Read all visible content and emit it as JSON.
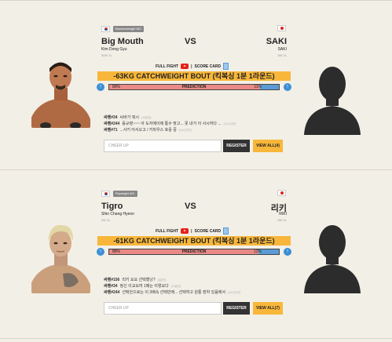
{
  "cards": [
    {
      "weight_tag": "Bantamweight WC",
      "left": {
        "name": "Big Mouth",
        "sub": "Kim Dong Gyu",
        "record": "50W 7L"
      },
      "vs": "VS",
      "right": {
        "name": "SAKI",
        "sub": "SAKI",
        "record": "9W 2L"
      },
      "full_fight": "FULL FIGHT",
      "score_card": "SCORE CARD",
      "bout": "-63KG CATCHWEIGHT BOUT (킥복싱 1분 1라운드)",
      "prediction": {
        "label": "PREDICTION",
        "left_pct": "89%",
        "right_pct": "11%",
        "left_fraction": 0.89
      },
      "comments": [
        {
          "user": "싸펜#34",
          "text": "씨바가 뭐시",
          "date": "(14분전)"
        },
        {
          "user": "싸펜#244",
          "text": "동규영~~~ 아 도자에이에 통수 맞고... 못 내가 이 사시하다 ...",
          "date": "(14시간전)"
        },
        {
          "user": "싸펜#71",
          "text": "...사키 어서오고 / 키마우스 호응 중",
          "date": "(14시간전)"
        }
      ],
      "cheer_placeholder": "CHEER UP",
      "register": "REGISTER",
      "view_all": "VIEW ALL(4)"
    },
    {
      "weight_tag": "Flyweight WC",
      "left": {
        "name": "Tigro",
        "sub": "Shin Chang Hyeon",
        "record": "3W 3L"
      },
      "vs": "VS",
      "right": {
        "name": "리키",
        "sub": "RIKI",
        "record": "5W 3L"
      },
      "full_fight": "FULL FIGHT",
      "score_card": "SCORE CARD",
      "bout": "-61KG CATCHWEIGHT BOUT (킥복싱 1분 1라운드)",
      "prediction": {
        "label": "PREDICTION",
        "left_pct": "88%",
        "right_pct": "12%",
        "left_fraction": 0.88
      },
      "comments": [
        {
          "user": "싸펜#156",
          "text": "리키 요요 선택했닝?",
          "date": "(8분전)"
        },
        {
          "user": "싸펜#34",
          "text": "정신 이교요여 1패는 이렇요다",
          "date": "(14분전)"
        },
        {
          "user": "싸펜#244",
          "text": "선택안으로는 이 3배속 선택반에... 선택하고 원통 장하 있음에서",
          "date": "(14시간전)"
        }
      ],
      "cheer_placeholder": "CHEER UP",
      "register": "REGISTER",
      "view_all": "VIEW ALL(7)"
    }
  ]
}
